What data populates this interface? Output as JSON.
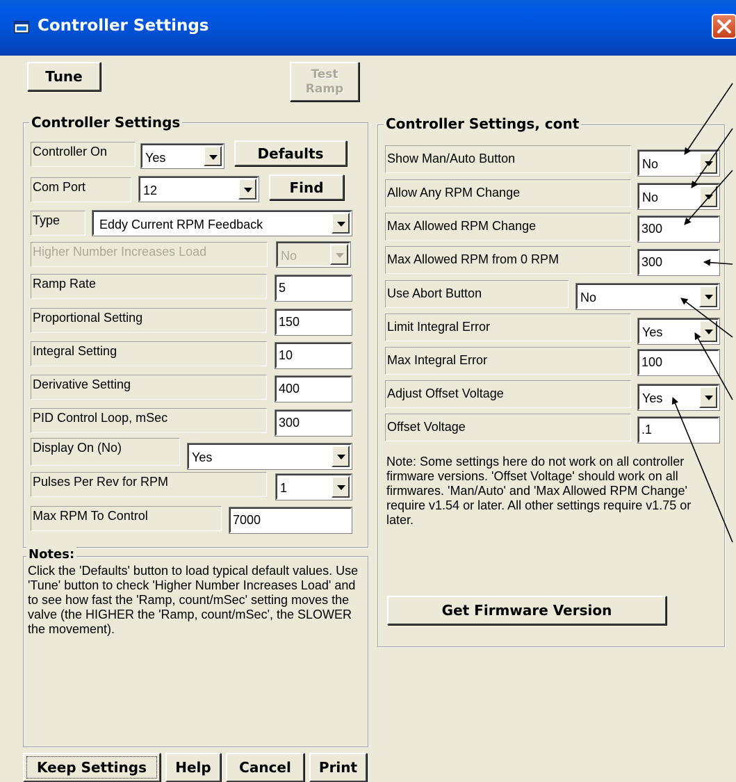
{
  "window": {
    "title": "Controller Settings",
    "icon": "app-window-icon",
    "close_icon": "close-x-icon"
  },
  "top_buttons": {
    "tune": "Tune",
    "test_ramp": "Test Ramp"
  },
  "left_group": {
    "title": "Controller Settings",
    "controller_on": {
      "label": "Controller On",
      "value": "Yes"
    },
    "defaults_button": "Defaults",
    "com_port": {
      "label": "Com Port",
      "value": "12"
    },
    "find_button": "Find",
    "type": {
      "label": "Type",
      "value": "Eddy Current RPM Feedback"
    },
    "higher_number": {
      "label": "Higher Number Increases Load",
      "value": "No"
    },
    "ramp_rate": {
      "label": "Ramp Rate",
      "value": "5"
    },
    "proportional": {
      "label": "Proportional Setting",
      "value": "150"
    },
    "integral": {
      "label": "Integral Setting",
      "value": "10"
    },
    "derivative": {
      "label": "Derivative Setting",
      "value": "400"
    },
    "pid_loop": {
      "label": "PID Control Loop, mSec",
      "value": "300"
    },
    "display_on": {
      "label": "Display On (No)",
      "value": "Yes"
    },
    "pulses_per_rev": {
      "label": "Pulses Per Rev for RPM",
      "value": "1"
    },
    "max_rpm": {
      "label": "Max RPM To Control",
      "value": "7000"
    }
  },
  "notes_group": {
    "title": "Notes:",
    "text": "Click the 'Defaults' button to load typical default values.  Use 'Tune' button to check 'Higher Number Increases Load' and to see how fast the 'Ramp, count/mSec' setting moves the valve (the HIGHER the 'Ramp, count/mSec', the SLOWER the movement)."
  },
  "right_group": {
    "title": "Controller Settings, cont",
    "show_man_auto": {
      "label": "Show Man/Auto Button",
      "value": "No"
    },
    "allow_any_rpm": {
      "label": "Allow Any RPM Change",
      "value": "No"
    },
    "max_allowed_rpm_change": {
      "label": "Max Allowed RPM Change",
      "value": "300"
    },
    "max_allowed_rpm_from_0": {
      "label": "Max Allowed RPM from 0 RPM",
      "value": "300"
    },
    "use_abort": {
      "label": "Use Abort Button",
      "value": "No"
    },
    "limit_integral": {
      "label": "Limit Integral Error",
      "value": "Yes"
    },
    "max_integral": {
      "label": "Max Integral Error",
      "value": "100"
    },
    "adjust_offset": {
      "label": "Adjust Offset Voltage",
      "value": "Yes"
    },
    "offset_voltage": {
      "label": "Offset Voltage",
      "value": ".1"
    },
    "note": "Note:  Some settings here do not work on all controller firmware versions.  'Offset Voltage' should work on all firmwares.  'Man/Auto' and 'Max Allowed RPM Change' require v1.54 or later.  All other settings require v1.75 or later.",
    "get_firmware_button": "Get Firmware Version"
  },
  "bottom_buttons": {
    "keep_settings": "Keep Settings",
    "help": "Help",
    "cancel": "Cancel",
    "print": "Print"
  }
}
